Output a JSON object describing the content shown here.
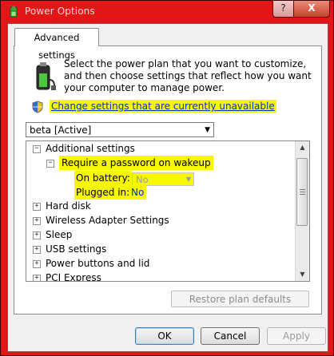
{
  "window": {
    "title": "Power Options",
    "help_label": "?",
    "close_label": "X"
  },
  "tab": {
    "label": "Advanced settings"
  },
  "intro": {
    "text": "Select the power plan that you want to customize, and then choose settings that reflect how you want your computer to manage power."
  },
  "change_link": "Change settings that are currently unavailable",
  "plan_select": {
    "value": "beta [Active]"
  },
  "tree": {
    "items": [
      {
        "label": "Additional settings",
        "expander": "−"
      },
      {
        "label": "Require a password on wakeup",
        "expander": "−"
      },
      {
        "label": "On battery:"
      },
      {
        "label": "Plugged in:"
      },
      {
        "label": "Hard disk",
        "expander": "+"
      },
      {
        "label": "Wireless Adapter Settings",
        "expander": "+"
      },
      {
        "label": "Sleep",
        "expander": "+"
      },
      {
        "label": "USB settings",
        "expander": "+"
      },
      {
        "label": "Power buttons and lid",
        "expander": "+"
      },
      {
        "label": "PCI Express",
        "expander": "+"
      }
    ],
    "on_battery_value": "No",
    "plugged_in_value": "No"
  },
  "buttons": {
    "restore": "Restore plan defaults",
    "ok": "OK",
    "cancel": "Cancel",
    "apply": "Apply"
  },
  "icons": {
    "window": "power-options-icon",
    "battery": "battery-plug-icon",
    "shield": "uac-shield-icon"
  },
  "colors": {
    "title_bar": "#e21616",
    "highlight": "#f7f700",
    "link": "#0033cc"
  }
}
